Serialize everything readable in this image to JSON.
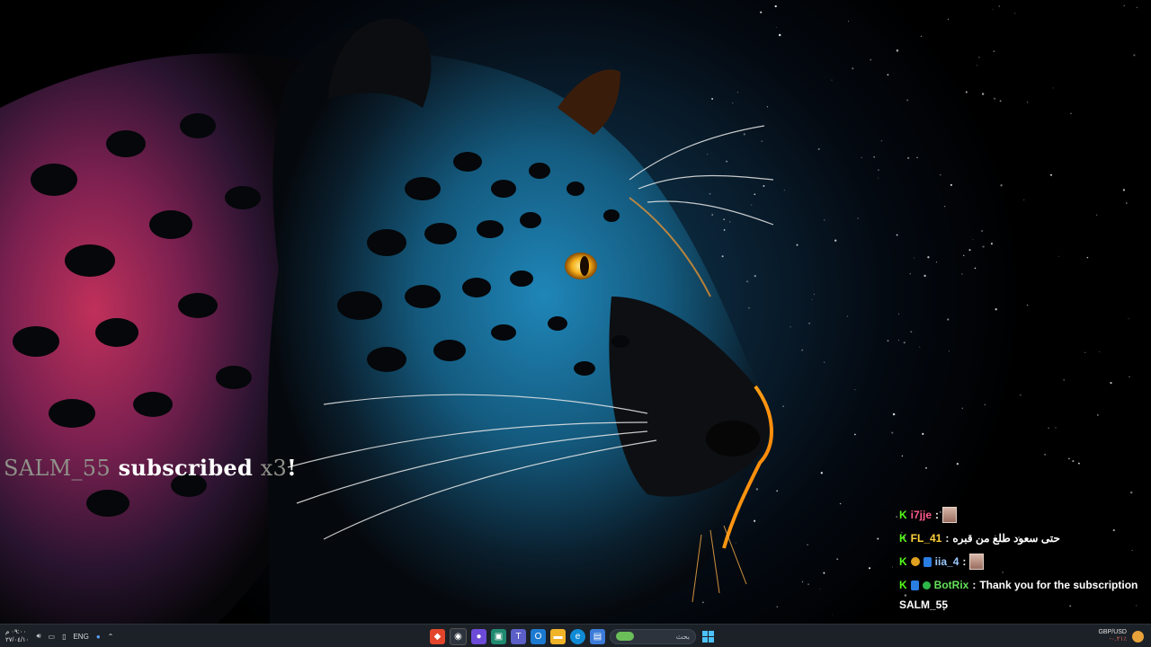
{
  "alert": {
    "username": "SALM_55",
    "action": "subscribed",
    "multiplier": "x3",
    "exclaim": "!"
  },
  "chat": {
    "messages": [
      {
        "user": "i7jje",
        "sep": ":",
        "text": "",
        "has_emote": true,
        "name_color": "#ff5a8a"
      },
      {
        "user": "FL_41",
        "sep": ":",
        "text": "حتى سعود طلع من قبره",
        "has_emote": false,
        "name_color": "#ffd23a"
      },
      {
        "user": "iia_4",
        "sep": ":",
        "text": "",
        "has_emote": true,
        "name_color": "#9cc9ff"
      },
      {
        "user": "BotRix",
        "sep": ":",
        "text": "Thank you for the subscription",
        "text_cont": "SALM_55",
        "has_emote": false,
        "name_color": "#64e15a"
      }
    ],
    "platform_icon": "K"
  },
  "taskbar": {
    "time": "٠٩:٠٠ م",
    "date": "٢٧/٠٤/١٠",
    "language": "ENG",
    "search_placeholder": "بحث",
    "ticker_symbol": "GBP/USD",
    "ticker_value": "-٠.٢١٪"
  },
  "colors": {
    "kick_green": "#53fc18",
    "taskbar_bg": "#1c2127"
  }
}
